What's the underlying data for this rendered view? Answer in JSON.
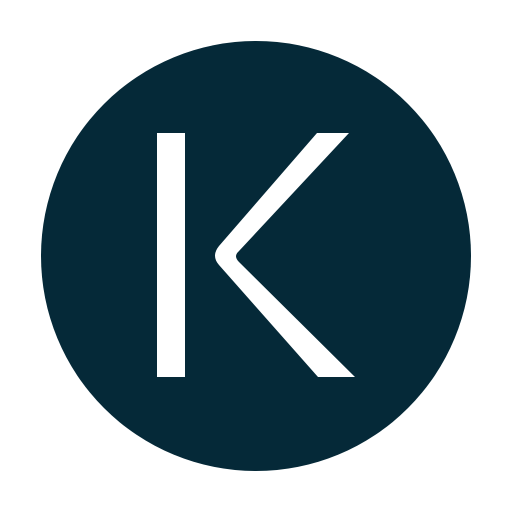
{
  "logo": {
    "letter": "K",
    "background_color": "#052938",
    "letter_color": "#ffffff",
    "page_color": "#ffffff"
  }
}
